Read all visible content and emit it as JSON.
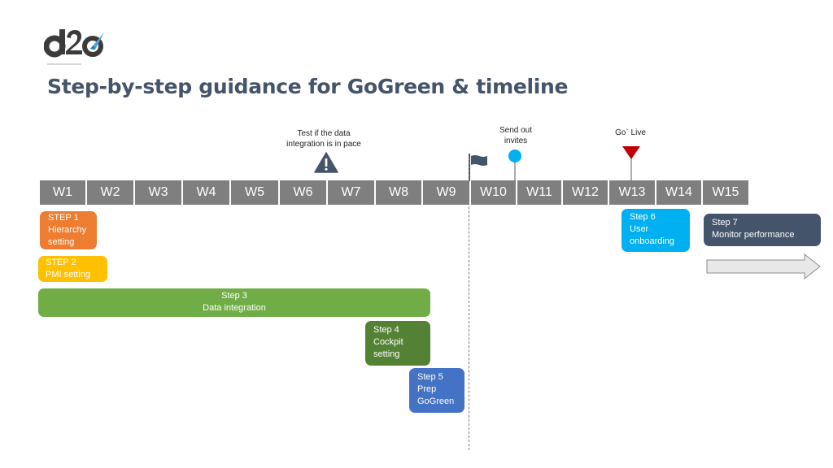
{
  "header": {
    "logo_text": "d2o",
    "title": "Step-by-step guidance for GoGreen & timeline"
  },
  "colors": {
    "title": "#44546a",
    "week_bar": "#7f7f7f",
    "step1": "#ed7d31",
    "step2": "#ffc000",
    "step3": "#70ad47",
    "step4": "#548235",
    "step5": "#4472c4",
    "step6": "#00b0f0",
    "step7": "#44546a",
    "warning": "#44546a",
    "invite_marker": "#00b0f0",
    "golive_marker": "#c00000"
  },
  "milestones": [
    {
      "id": "test",
      "lines": [
        "Test if the data",
        "integration is in pace"
      ],
      "icon": "warning-triangle-icon"
    },
    {
      "id": "flag",
      "lines": [],
      "icon": "flag-icon"
    },
    {
      "id": "invites",
      "lines": [
        "Send out",
        "invites"
      ],
      "icon": "circle-pin-icon"
    },
    {
      "id": "golive",
      "lines": [
        "Go` Live"
      ],
      "icon": "red-triangle-pin-icon"
    }
  ],
  "weeks": [
    "W1",
    "W2",
    "W3",
    "W4",
    "W5",
    "W6",
    "W7",
    "W8",
    "W9",
    "W10",
    "W11",
    "W12",
    "W13",
    "W14",
    "W15"
  ],
  "steps": [
    {
      "id": "step1",
      "lines": [
        "STEP 1",
        "Hierarchy",
        "setting"
      ]
    },
    {
      "id": "step2",
      "lines": [
        "STEP 2",
        "PMI setting"
      ]
    },
    {
      "id": "step3",
      "lines": [
        "Step 3",
        "Data integration"
      ]
    },
    {
      "id": "step4",
      "lines": [
        "Step 4",
        "Cockpit",
        "setting"
      ]
    },
    {
      "id": "step5",
      "lines": [
        "Step 5",
        "Prep",
        "GoGreen"
      ]
    },
    {
      "id": "step6",
      "lines": [
        "Step 6",
        "User",
        "onboarding"
      ]
    },
    {
      "id": "step7",
      "lines": [
        "Step 7",
        "Monitor performance"
      ]
    }
  ],
  "continuation_arrow": "right-arrow-icon"
}
